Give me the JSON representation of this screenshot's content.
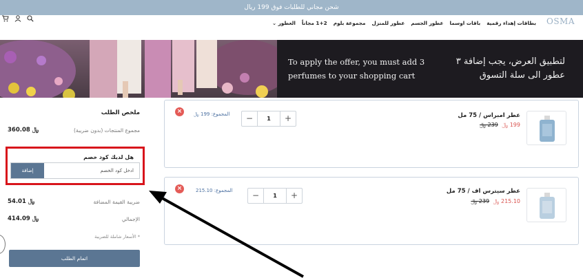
{
  "top_bar": {
    "text": "شحن مجاني للطلبات فوق 199 ريال"
  },
  "header": {
    "logo": "OSMA",
    "nav": [
      "العطور ⌄",
      "1+2 مجاناً",
      "مجموعة بلوم",
      "عطور للمنزل",
      "عطور الجسم",
      "باقات اوسما",
      "بطاقات إهداء رقمية"
    ],
    "icons": [
      "cart-icon",
      "user-icon",
      "search-icon"
    ]
  },
  "banner": {
    "english": "To apply the offer, you must add 3 perfumes to your shopping cart",
    "arabic": "لتطبيق العرض، يجب إضافة ٣ عطور الى سلة التسوق"
  },
  "summary": {
    "title": "ملخص الطلب",
    "subtotal_label": "مجموع المنتجات (بدون ضريبة)",
    "subtotal_value": "360.08 ﷼",
    "coupon_title": "هل لديك كود خصم",
    "coupon_placeholder": "ادخل كود الخصم",
    "coupon_button": "إضافة",
    "vat_label": "ضريبة القيمة المضافة",
    "vat_value": "54.01 ﷼",
    "total_label": "الإجمالي",
    "total_value": "414.09 ﷼",
    "note": "* الأسعار شاملة للضريبة",
    "checkout_button": "اتمام الطلب"
  },
  "items": [
    {
      "name": "عطر امبراس / 75 مل",
      "new_price": "199 ﷼",
      "old_price": "239 ﷼",
      "quantity": "1",
      "line_total": "المجموع: 199 ﷼"
    },
    {
      "name": "عطر سيترس اف / 75 مل",
      "new_price": "215.10 ﷼",
      "old_price": "239 ﷼",
      "quantity": "1",
      "line_total": "المجموع: 215.10"
    }
  ],
  "colors": {
    "accent": "#5b7693",
    "highlight_box": "#d8141b",
    "sale_price": "#d9534f",
    "top_bar": "#9fb6c9"
  }
}
